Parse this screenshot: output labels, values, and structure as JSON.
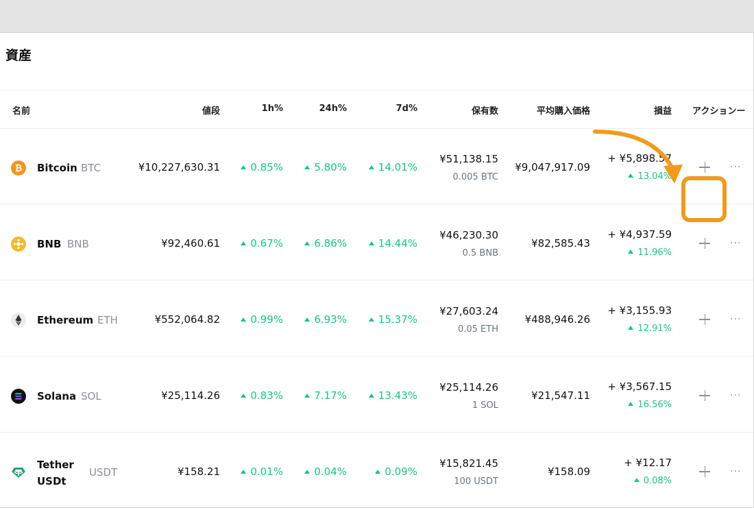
{
  "page": {
    "title": "資産"
  },
  "columns": {
    "name": "名前",
    "price": "値段",
    "h1": "1h%",
    "h24": "24h%",
    "d7": "7d%",
    "holdings": "保有数",
    "avg_price": "平均購入価格",
    "pnl": "損益",
    "actions": "アクション"
  },
  "rows": [
    {
      "name": "Bitcoin",
      "symbol": "BTC",
      "price": "¥10,227,630.31",
      "h1": "0.85%",
      "h24": "5.80%",
      "d7": "14.01%",
      "holdings_value": "¥51,138.15",
      "holdings_amount": "0.005 BTC",
      "avg_price": "¥9,047,917.09",
      "pnl_value": "+ ¥5,898.57",
      "pnl_pct": "13.04%",
      "icon": "bitcoin-icon",
      "color": "#f7931a"
    },
    {
      "name": "BNB",
      "symbol": "BNB",
      "price": "¥92,460.61",
      "h1": "0.67%",
      "h24": "6.86%",
      "d7": "14.44%",
      "holdings_value": "¥46,230.30",
      "holdings_amount": "0.5 BNB",
      "avg_price": "¥82,585.43",
      "pnl_value": "+ ¥4,937.59",
      "pnl_pct": "11.96%",
      "icon": "bnb-icon",
      "color": "#f3ba2f"
    },
    {
      "name": "Ethereum",
      "symbol": "ETH",
      "price": "¥552,064.82",
      "h1": "0.99%",
      "h24": "6.93%",
      "d7": "15.37%",
      "holdings_value": "¥27,603.24",
      "holdings_amount": "0.05 ETH",
      "avg_price": "¥488,946.26",
      "pnl_value": "+ ¥3,155.93",
      "pnl_pct": "12.91%",
      "icon": "ethereum-icon",
      "color": "#ececec"
    },
    {
      "name": "Solana",
      "symbol": "SOL",
      "price": "¥25,114.26",
      "h1": "0.83%",
      "h24": "7.17%",
      "d7": "13.43%",
      "holdings_value": "¥25,114.26",
      "holdings_amount": "1 SOL",
      "avg_price": "¥21,547.11",
      "pnl_value": "+ ¥3,567.15",
      "pnl_pct": "16.56%",
      "icon": "solana-icon",
      "color": "#111111"
    },
    {
      "name": "Tether USDt",
      "name_line1": "Tether",
      "name_line2": "USDt",
      "symbol": "USDT",
      "price": "¥158.21",
      "h1": "0.01%",
      "h24": "0.04%",
      "d7": "0.09%",
      "holdings_value": "¥15,821.45",
      "holdings_amount": "100 USDT",
      "avg_price": "¥158.09",
      "pnl_value": "+ ¥12.17",
      "pnl_pct": "0.08%",
      "icon": "tether-icon",
      "color": "#26a17b"
    }
  ],
  "colors": {
    "positive": "#16c784",
    "highlight": "#f29a1b"
  },
  "more_icon_text": "···"
}
